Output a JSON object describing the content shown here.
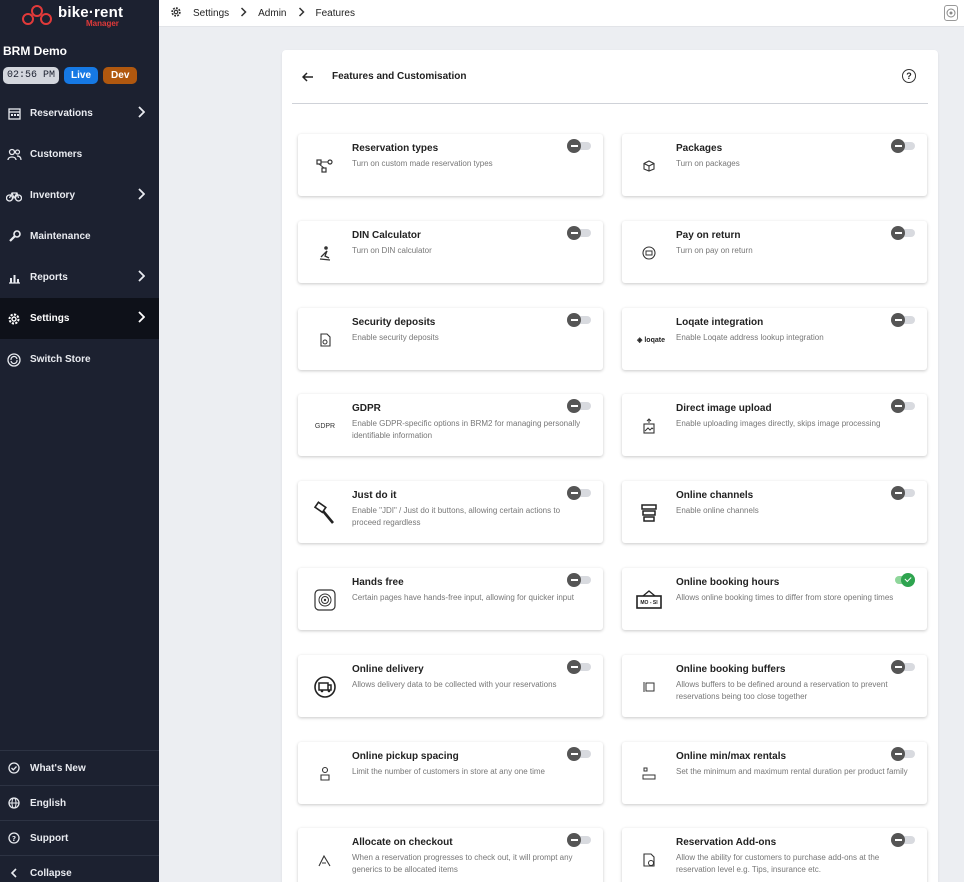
{
  "app": {
    "logo_text": "bike·rent",
    "logo_subtext": "Manager"
  },
  "store": {
    "name": "BRM Demo",
    "time": "02:56 PM",
    "live_badge": "Live",
    "dev_badge": "Dev"
  },
  "sidebar": {
    "items": [
      {
        "label": "Reservations",
        "icon": "calendar-icon",
        "chevron": true,
        "active": false
      },
      {
        "label": "Customers",
        "icon": "users-icon",
        "chevron": false,
        "active": false
      },
      {
        "label": "Inventory",
        "icon": "bike-icon",
        "chevron": true,
        "active": false
      },
      {
        "label": "Maintenance",
        "icon": "wrench-icon",
        "chevron": false,
        "active": false
      },
      {
        "label": "Reports",
        "icon": "chart-icon",
        "chevron": true,
        "active": false
      },
      {
        "label": "Settings",
        "icon": "gear-icon",
        "chevron": true,
        "active": true
      },
      {
        "label": "Switch Store",
        "icon": "switch-icon",
        "chevron": false,
        "active": false
      }
    ],
    "bottom": [
      {
        "label": "What's New",
        "icon": "badge-check-icon"
      },
      {
        "label": "English",
        "icon": "globe-icon"
      },
      {
        "label": "Support",
        "icon": "help-circle-icon"
      },
      {
        "label": "Collapse",
        "icon": "chevron-left-icon"
      }
    ]
  },
  "breadcrumb": [
    "Settings",
    "Admin",
    "Features"
  ],
  "panel": {
    "title": "Features and Customisation"
  },
  "features": [
    {
      "title": "Reservation types",
      "desc": "Turn on custom made reservation types",
      "icon": "nodes-icon",
      "enabled": false
    },
    {
      "title": "Packages",
      "desc": "Turn on packages",
      "icon": "box-icon",
      "enabled": false
    },
    {
      "title": "DIN Calculator",
      "desc": "Turn on DIN calculator",
      "icon": "ski-icon",
      "enabled": false
    },
    {
      "title": "Pay on return",
      "desc": "Turn on pay on return",
      "icon": "wallet-icon",
      "enabled": false
    },
    {
      "title": "Security deposits",
      "desc": "Enable security deposits",
      "icon": "deposit-icon",
      "enabled": false
    },
    {
      "title": "Loqate integration",
      "desc": "Enable Loqate address lookup integration",
      "icon": "loqate-logo",
      "icon_text": "loqate",
      "enabled": false
    },
    {
      "title": "GDPR",
      "desc": "Enable GDPR-specific options in BRM2 for managing personally identifiable information",
      "icon": "gdpr-icon",
      "icon_text": "GDPR",
      "enabled": false
    },
    {
      "title": "Direct image upload",
      "desc": "Enable uploading images directly, skips image processing",
      "icon": "image-upload-icon",
      "enabled": false
    },
    {
      "title": "Just do it",
      "desc": "Enable \"JDI\" / Just do it buttons, allowing certain actions to proceed regardless",
      "icon": "hammer-icon",
      "enabled": false
    },
    {
      "title": "Online channels",
      "desc": "Enable online channels",
      "icon": "stack-icon",
      "enabled": false
    },
    {
      "title": "Hands free",
      "desc": "Certain pages have hands-free input, allowing for quicker input",
      "icon": "contactless-icon",
      "enabled": false
    },
    {
      "title": "Online booking hours",
      "desc": "Allows online booking times to differ from store opening times",
      "icon": "hours-sign-icon",
      "icon_text": "MO - SI",
      "enabled": true
    },
    {
      "title": "Online delivery",
      "desc": "Allows delivery data to be collected with your reservations",
      "icon": "van-icon",
      "enabled": false
    },
    {
      "title": "Online booking buffers",
      "desc": "Allows buffers to be defined around a reservation to prevent reservations being too close together",
      "icon": "buffer-icon",
      "enabled": false
    },
    {
      "title": "Online pickup spacing",
      "desc": "Limit the number of customers in store at any one time",
      "icon": "pickup-icon",
      "enabled": false
    },
    {
      "title": "Online min/max rentals",
      "desc": "Set the minimum and maximum rental duration per product family",
      "icon": "minmax-icon",
      "enabled": false
    },
    {
      "title": "Allocate on checkout",
      "desc": "When a reservation progresses to check out, it will prompt any generics to be allocated items",
      "icon": "allocate-icon",
      "enabled": false
    },
    {
      "title": "Reservation Add-ons",
      "desc": "Allow the ability for customers to purchase add-ons at the reservation level e.g. Tips, insurance etc.",
      "icon": "addon-icon",
      "enabled": false
    }
  ],
  "colors": {
    "sidebar_bg": "#1c2130",
    "live": "#1679e4",
    "dev": "#b0580f",
    "brand_red": "#e23a3a",
    "toggle_on": "#2ea44f"
  }
}
